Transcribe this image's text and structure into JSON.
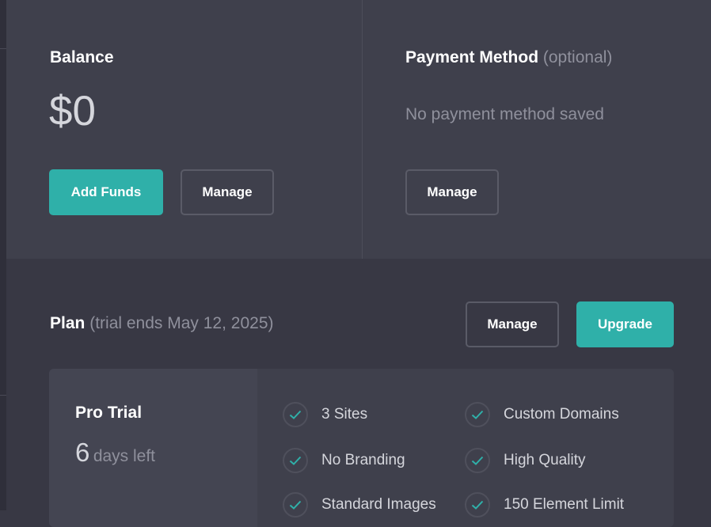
{
  "balance": {
    "title": "Balance",
    "amount": "$0",
    "add_funds_label": "Add Funds",
    "manage_label": "Manage"
  },
  "payment": {
    "title": "Payment Method",
    "title_note": "(optional)",
    "empty_text": "No payment method saved",
    "manage_label": "Manage"
  },
  "plan": {
    "title": "Plan",
    "trial_note": "(trial ends May 12, 2025)",
    "manage_label": "Manage",
    "upgrade_label": "Upgrade",
    "name": "Pro Trial",
    "days_left_number": "6",
    "days_left_label": "days left",
    "features": [
      "3 Sites",
      "Custom Domains",
      "No Branding",
      "High Quality",
      "Standard Images",
      "150 Element Limit"
    ]
  },
  "colors": {
    "accent": "#2fb0a9",
    "background": "#383844",
    "card": "#3f404c",
    "muted_text": "#8f909c"
  },
  "icons": {
    "feature_check": "check-icon"
  }
}
